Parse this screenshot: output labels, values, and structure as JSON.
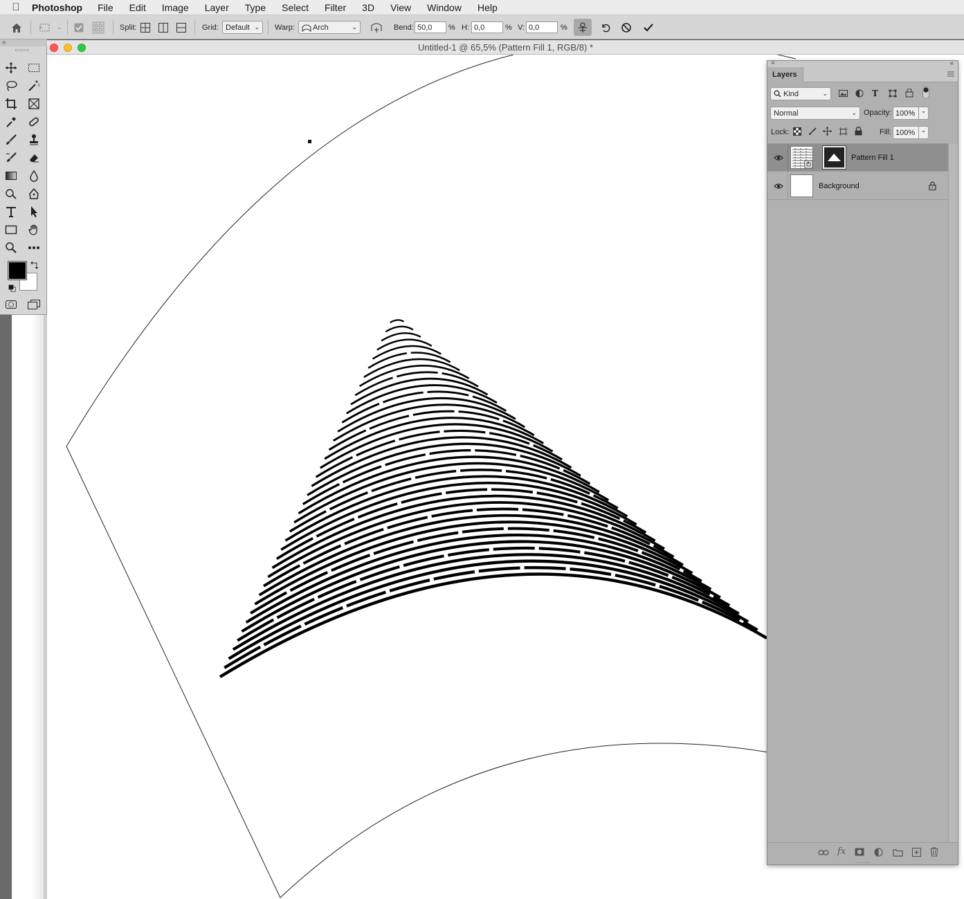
{
  "menubar": {
    "app_name": "Photoshop",
    "items": [
      "File",
      "Edit",
      "Image",
      "Layer",
      "Type",
      "Select",
      "Filter",
      "3D",
      "View",
      "Window",
      "Help"
    ]
  },
  "options": {
    "split_label": "Split:",
    "grid_label": "Grid:",
    "grid_value": "Default",
    "warp_label": "Warp:",
    "warp_value": "Arch",
    "bend_label": "Bend:",
    "bend_value": "50,0",
    "h_label": "H:",
    "h_value": "0,0",
    "v_label": "V:",
    "v_value": "0,0",
    "percent": "%"
  },
  "document": {
    "title": "Untitled-1 @ 65,5% (Pattern Fill 1, RGB/8) *"
  },
  "layers_panel": {
    "tab_label": "Layers",
    "filter_kind": "Kind",
    "blend_mode": "Normal",
    "opacity_label": "Opacity:",
    "opacity_value": "100%",
    "lock_label": "Lock:",
    "fill_label": "Fill:",
    "fill_value": "100%",
    "layers": [
      {
        "name": "Pattern Fill 1",
        "selected": true
      },
      {
        "name": "Background",
        "locked": true
      }
    ]
  },
  "colors": {
    "foreground": "#000000",
    "background": "#ffffff",
    "selected_layer": "#8f8f8f"
  }
}
